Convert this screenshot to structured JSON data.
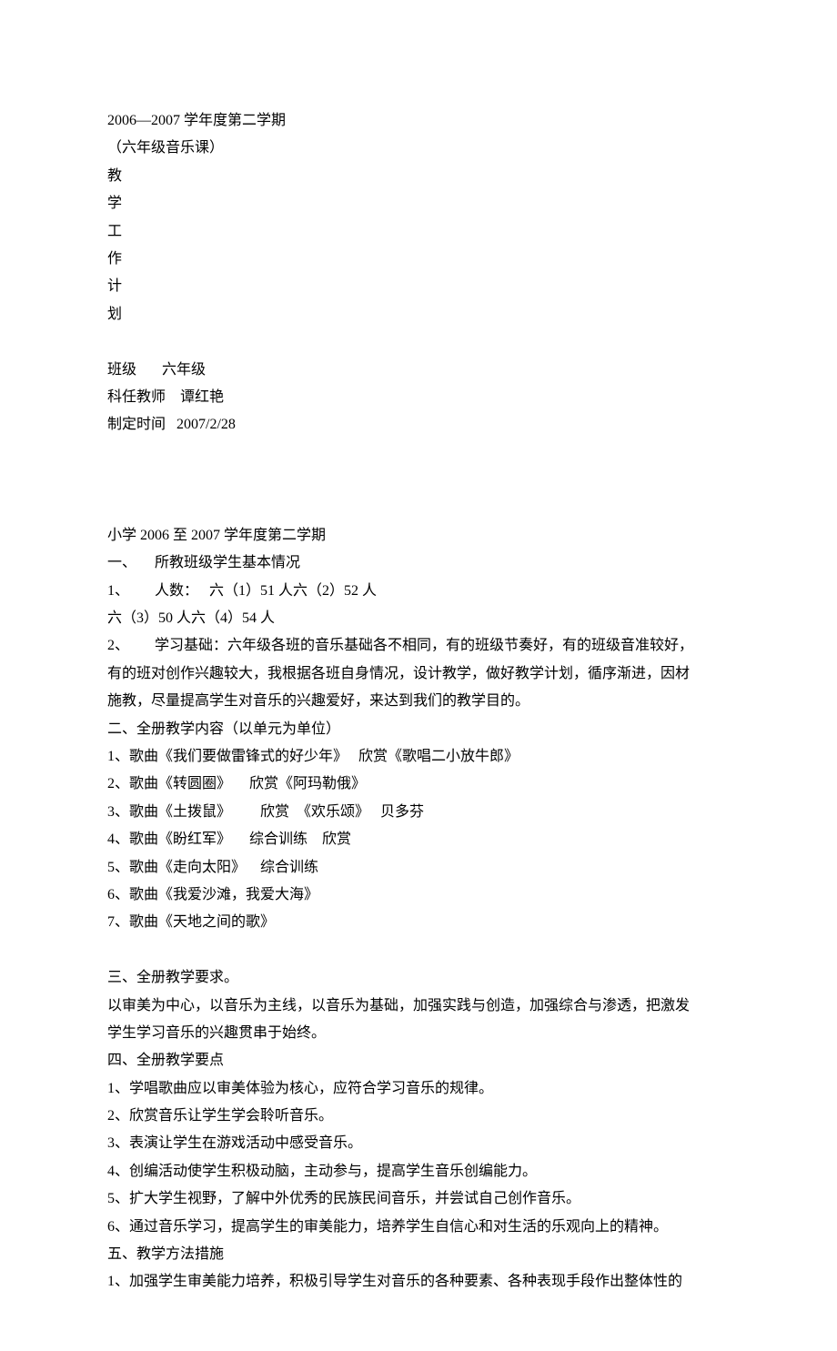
{
  "header": {
    "semester": "2006—2007 学年度第二学期",
    "grade_course": "（六年级音乐课）",
    "title_chars": [
      "教",
      "学",
      "工",
      "作",
      "计",
      "划"
    ],
    "class_line": "班级       六年级",
    "teacher_line": "科任教师    谭红艳",
    "date_line": "制定时间   2007/2/28"
  },
  "body": {
    "school_semester": "小学 2006 至 2007 学年度第二学期",
    "s1_title": "一、     所教班级学生基本情况",
    "s1_item1": "1、       人数：   六（1）51 人六（2）52 人",
    "s1_item1b": "六（3）50 人六（4）54 人",
    "s1_item2a": "2、       学习基础：六年级各班的音乐基础各不相同，有的班级节奏好，有的班级音准较好，",
    "s1_item2b": "有的班对创作兴趣较大，我根据各班自身情况，设计教学，做好教学计划，循序渐进，因材",
    "s1_item2c": "施教，尽量提高学生对音乐的兴趣爱好，来达到我们的教学目的。",
    "s2_title": "二、全册教学内容（以单元为单位）",
    "s2_items": [
      "1、歌曲《我们要做雷锋式的好少年》   欣赏《歌唱二小放牛郎》",
      "2、歌曲《转圆圈》     欣赏《阿玛勒俄》",
      "3、歌曲《土拨鼠》        欣赏  《欢乐颂》   贝多芬",
      "4、歌曲《盼红军》     综合训练    欣赏",
      "5、歌曲《走向太阳》    综合训练",
      "6、歌曲《我爱沙滩，我爱大海》",
      "7、歌曲《天地之间的歌》"
    ],
    "s3_title": "三、全册教学要求。",
    "s3_p1a": "以审美为中心，以音乐为主线，以音乐为基础，加强实践与创造，加强综合与渗透，把激发",
    "s3_p1b": "学生学习音乐的兴趣贯串于始终。",
    "s4_title": "四、全册教学要点",
    "s4_items": [
      "1、学唱歌曲应以审美体验为核心，应符合学习音乐的规律。",
      "2、欣赏音乐让学生学会聆听音乐。",
      "3、表演让学生在游戏活动中感受音乐。",
      "4、创编活动使学生积极动脑，主动参与，提高学生音乐创编能力。",
      "5、扩大学生视野，了解中外优秀的民族民间音乐，并尝试自己创作音乐。",
      "6、通过音乐学习，提高学生的审美能力，培养学生自信心和对生活的乐观向上的精神。"
    ],
    "s5_title": "五、教学方法措施",
    "s5_item1": "1、加强学生审美能力培养，积极引导学生对音乐的各种要素、各种表现手段作出整体性的"
  }
}
